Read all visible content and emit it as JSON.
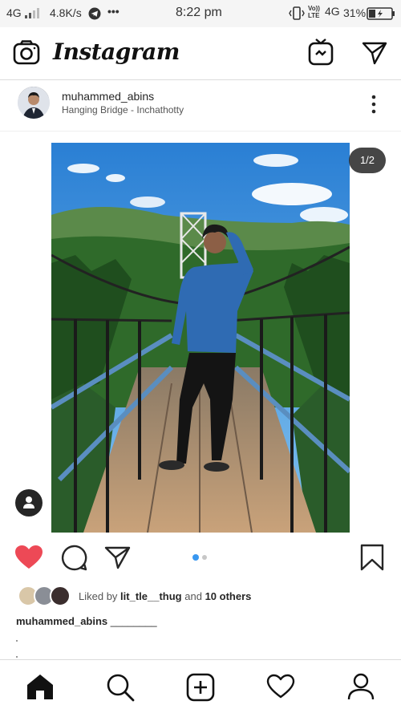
{
  "status_bar": {
    "network": "4G",
    "speed": "4.8K/s",
    "more": "•••",
    "time": "8:22 pm",
    "volte": "Vo)) LTE",
    "network2": "4G",
    "battery_percent": "31%"
  },
  "header": {
    "app_title": "Instagram"
  },
  "post": {
    "username": "muhammed_abins",
    "location": "Hanging Bridge - Inchathotty",
    "page_indicator": "1/2",
    "carousel_count": 2,
    "carousel_active_index": 0,
    "liked": true,
    "likes_prefix": "Liked by",
    "likes_user": "lit_tle__thug",
    "likes_suffix": "and",
    "likes_others": "10 others",
    "caption_user": "muhammed_abins",
    "caption_text": "________"
  },
  "colors": {
    "like_red": "#ed4956",
    "dot_active": "#3897f0",
    "dot_inactive": "#c7c7c7",
    "text": "#262626"
  },
  "icons": {
    "camera": "camera-icon",
    "igtv": "igtv-icon",
    "direct": "paper-plane-icon",
    "more": "more-vertical-icon",
    "like": "heart-icon",
    "comment": "comment-icon",
    "share": "paper-plane-icon",
    "save": "bookmark-icon",
    "home": "home-icon",
    "search": "search-icon",
    "add": "add-post-icon",
    "activity": "heart-outline-icon",
    "profile": "profile-icon",
    "tag": "user-tag-icon"
  }
}
